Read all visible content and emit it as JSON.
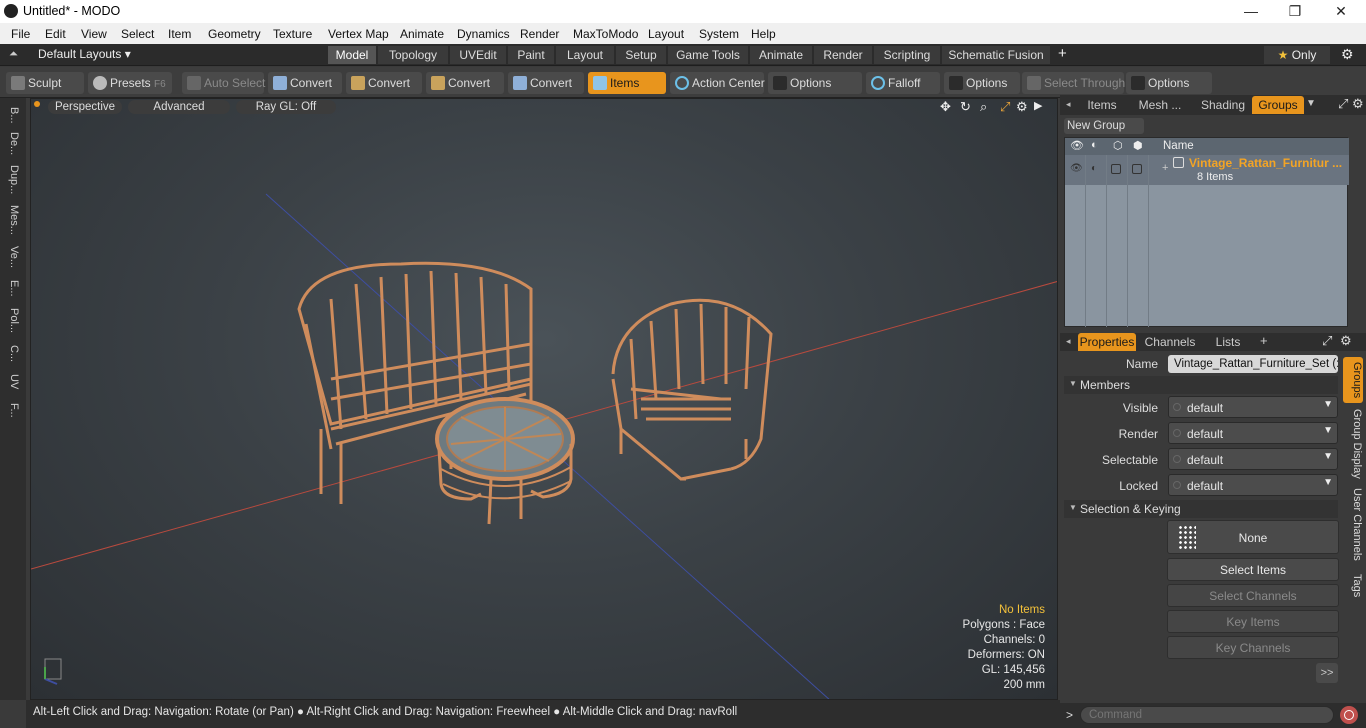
{
  "window": {
    "title": "Untitled* - MODO",
    "minimize": "—",
    "restore": "❐",
    "close": "✕"
  },
  "menu": [
    "File",
    "Edit",
    "View",
    "Select",
    "Item",
    "Geometry",
    "Texture",
    "Vertex Map",
    "Animate",
    "Dynamics",
    "Render",
    "MaxToModo",
    "Layout",
    "System",
    "Help"
  ],
  "layouts": {
    "selector": "Default Layouts ▾",
    "tabs": [
      "Model",
      "Topology",
      "UVEdit",
      "Paint",
      "Layout",
      "Setup",
      "Game Tools",
      "Animate",
      "Render",
      "Scripting",
      "Schematic Fusion"
    ],
    "active_tab": "Model",
    "add": "+",
    "only": "Only"
  },
  "toolbar": {
    "sculpt": "Sculpt",
    "presets": "Presets",
    "presets_key": "F6",
    "auto_select": "Auto Select",
    "convert1": "Convert",
    "convert2": "Convert",
    "convert3": "Convert",
    "convert4": "Convert",
    "items": "Items",
    "action_center": "Action Center",
    "options1": "Options",
    "falloff": "Falloff",
    "options2": "Options",
    "select_through": "Select Through",
    "options3": "Options"
  },
  "left_tabs": [
    "B...",
    "De...",
    "Dup...",
    "Mes...",
    "Ve...",
    "E...",
    "Pol...",
    "C...",
    "UV",
    "F..."
  ],
  "viewport": {
    "perspective": "Perspective",
    "advanced": "Advanced",
    "raygl": "Ray GL: Off",
    "hud": {
      "no_items": "No Items",
      "polygons": "Polygons : Face",
      "channels": "Channels: 0",
      "deformers": "Deformers: ON",
      "gl": "GL: 145,456",
      "scale": "200 mm"
    }
  },
  "status": "Alt-Left Click and Drag: Navigation: Rotate (or Pan) ● Alt-Right Click and Drag: Navigation: Freewheel ● Alt-Middle Click and Drag: navRoll",
  "groups_panel": {
    "tabs": [
      "Items",
      "Mesh ...",
      "Shading",
      "Groups"
    ],
    "active": "Groups",
    "new_group": "New Group",
    "col_name": "Name",
    "group_name": "Vintage_Rattan_Furnitur ...",
    "group_count": "8 Items"
  },
  "properties": {
    "tabs": [
      "Properties",
      "Channels",
      "Lists"
    ],
    "active": "Properties",
    "add": "+",
    "name_label": "Name",
    "name_value": "Vintage_Rattan_Furniture_Set (:",
    "members": "Members",
    "rows": [
      {
        "label": "Visible",
        "value": "default"
      },
      {
        "label": "Render",
        "value": "default"
      },
      {
        "label": "Selectable",
        "value": "default"
      },
      {
        "label": "Locked",
        "value": "default"
      }
    ],
    "sel_keying": "Selection & Keying",
    "none": "None",
    "select_items": "Select Items",
    "select_channels": "Select Channels",
    "key_items": "Key Items",
    "key_channels": "Key Channels",
    "more": ">>",
    "side_tabs": [
      "Groups",
      "Group Display",
      "User Channels",
      "Tags"
    ]
  },
  "command": {
    "prompt": ">",
    "placeholder": "Command"
  },
  "colors": {
    "accent": "#e8951d",
    "group_name": "#f3a425",
    "warn": "#f3c13a"
  }
}
